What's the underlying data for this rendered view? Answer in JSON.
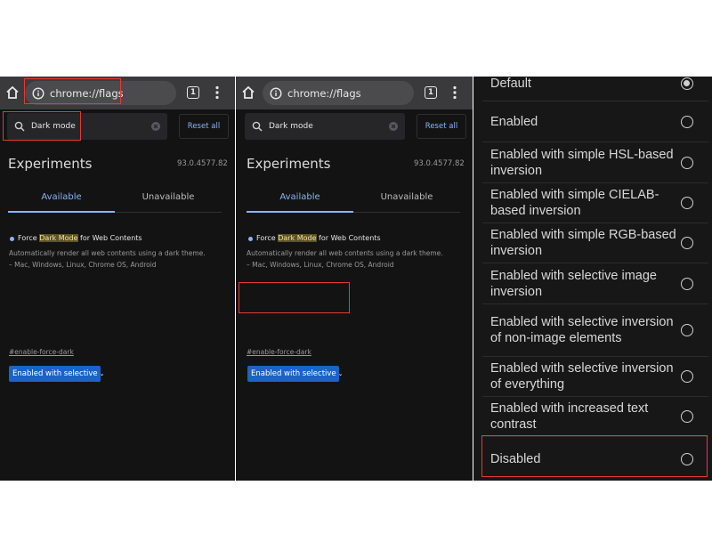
{
  "browser": {
    "url": "chrome://flags",
    "tab_count": "1"
  },
  "flags_page": {
    "search_value": "Dark mode",
    "reset_label": "Reset all",
    "title": "Experiments",
    "version": "93.0.4577.82",
    "tabs": [
      {
        "label": "Available",
        "active": true
      },
      {
        "label": "Unavailable",
        "active": false
      }
    ],
    "flag": {
      "title_before": "Force ",
      "title_highlight": "Dark Mode",
      "title_after": " for Web Contents",
      "description_line1": "Automatically render all web contents using a dark theme.",
      "description_line2": "– Mac, Windows, Linux, Chrome OS, Android",
      "link": "#enable-force-dark",
      "selected_value": "Enabled with selective",
      "caret": "⌄"
    }
  },
  "options": [
    {
      "label": "Default",
      "checked": true
    },
    {
      "label": "Enabled",
      "checked": false
    },
    {
      "label": "Enabled with simple HSL-based inversion",
      "checked": false
    },
    {
      "label": "Enabled with simple CIELAB-based inversion",
      "checked": false
    },
    {
      "label": "Enabled with simple RGB-based inversion",
      "checked": false
    },
    {
      "label": "Enabled with selective image inversion",
      "checked": false
    },
    {
      "label": "Enabled with selective inversion of non-image elements",
      "checked": false
    },
    {
      "label": "Enabled with selective inversion of everything",
      "checked": false
    },
    {
      "label": "Enabled with increased text contrast",
      "checked": false
    },
    {
      "label": "Disabled",
      "checked": false
    }
  ],
  "colors": {
    "accent": "#8ab4f8",
    "select_bg": "#1a63c8",
    "highlight_box": "#e53935",
    "panel_bg": "#131313"
  }
}
